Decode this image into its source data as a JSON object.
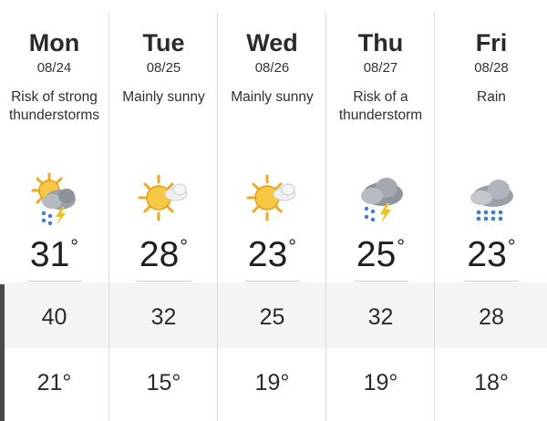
{
  "forecast": {
    "days": [
      {
        "day": "Mon",
        "date": "08/24",
        "condition_line1": "Risk of strong",
        "condition_line2": "thunderstorms",
        "icon": "sun-cloud-thunderstorm-icon",
        "high": "31",
        "mid": "40",
        "low": "21°"
      },
      {
        "day": "Tue",
        "date": "08/25",
        "condition_line1": "Mainly sunny",
        "condition_line2": "",
        "icon": "sunny-cloud-icon",
        "high": "28",
        "mid": "32",
        "low": "15°"
      },
      {
        "day": "Wed",
        "date": "08/26",
        "condition_line1": "Mainly sunny",
        "condition_line2": "",
        "icon": "sunny-cloud-icon",
        "high": "23",
        "mid": "25",
        "low": "19°"
      },
      {
        "day": "Thu",
        "date": "08/27",
        "condition_line1": "Risk of a",
        "condition_line2": "thunderstorm",
        "icon": "cloud-thunderstorm-icon",
        "high": "25",
        "mid": "32",
        "low": "19°"
      },
      {
        "day": "Fri",
        "date": "08/28",
        "condition_line1": "Rain",
        "condition_line2": "",
        "icon": "rain-cloud-icon",
        "high": "23",
        "mid": "28",
        "low": "18°"
      }
    ],
    "degree_symbol": "°"
  }
}
